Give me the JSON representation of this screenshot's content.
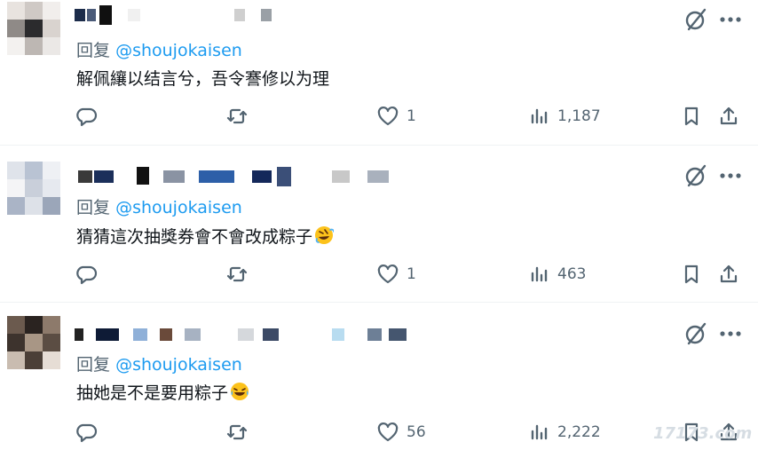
{
  "replies": [
    {
      "replying_prefix": "回复",
      "replying_handle": "@shoujokaisen",
      "text": "解佩纕以结言兮，吾令謇修以为理",
      "emoji": "",
      "comments": "",
      "retweets": "",
      "likes": "1",
      "views": "1,187"
    },
    {
      "replying_prefix": "回复",
      "replying_handle": "@shoujokaisen",
      "text": "猜猜這次抽獎券會不會改成粽子",
      "emoji": "rolling-on-floor-laughing-emoji",
      "comments": "",
      "retweets": "",
      "likes": "1",
      "views": "463"
    },
    {
      "replying_prefix": "回复",
      "replying_handle": "@shoujokaisen",
      "text": "抽她是不是要用粽子",
      "emoji": "tears-of-joy-emoji",
      "comments": "",
      "retweets": "",
      "likes": "56",
      "views": "2,222"
    }
  ],
  "watermark": "17173.com",
  "colors": {
    "text": "#0f1419",
    "secondary": "#536471",
    "link": "#1d9bf0",
    "divider": "#eff3f4"
  },
  "icons": {
    "comment": "speech-bubble-icon",
    "retweet": "retweet-arrows-icon",
    "like": "heart-icon",
    "views": "bar-chart-icon",
    "bookmark": "bookmark-icon",
    "share": "share-upload-icon",
    "grok": "grok-slash-circle-icon",
    "more": "three-dots-icon"
  }
}
